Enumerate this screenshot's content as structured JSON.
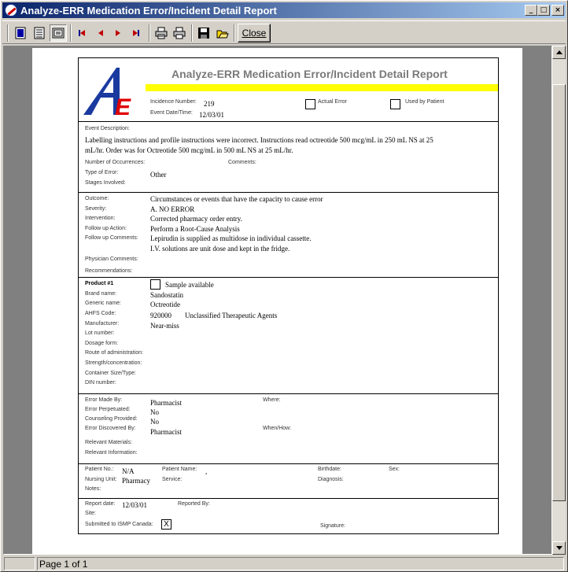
{
  "window": {
    "title": "Analyze-ERR Medication Error/Incident Detail Report"
  },
  "title_controls": {
    "minimize": "_",
    "maximize": "□",
    "close": "×"
  },
  "toolbar": {
    "close_label": "Close",
    "icons": [
      "single-page-icon",
      "multi-page-icon",
      "page-width-icon",
      "first-page-icon",
      "prev-page-icon",
      "next-page-icon",
      "last-page-icon",
      "print-setup-icon",
      "print-icon",
      "save-icon",
      "open-icon"
    ]
  },
  "report": {
    "title": "Analyze-ERR Medication Error/Incident Detail Report",
    "logo": {
      "letters": "AE",
      "colors": {
        "blue": "#1a3aa0",
        "red": "#e00000",
        "yellow": "#ffff00"
      }
    },
    "header": {
      "incidence_number_label": "Incidence Number:",
      "incidence_number": "219",
      "event_date_label": "Event Date/Time:",
      "event_date": "12/03/01",
      "actual_error_label": "Actual Error",
      "used_by_patient_label": "Used by Patient"
    },
    "event": {
      "description_label": "Event Description:",
      "description_line1": "Labelling instructions and profile instructions were incorrect. Instructions read octreotide 500 mcg/mL in 250 mL NS at 25",
      "description_line2": "mL/hr. Order was for Octreotide 500 mcg/mL in 500 mL NS at 25 mL/hr.",
      "occurrences_label": "Number of Occurrences:",
      "comments_label": "Comments:",
      "type_label": "Type of Error:",
      "type_value": "Other",
      "stages_label": "Stages Involved:"
    },
    "outcome": {
      "outcome_label": "Outcome:",
      "outcome_value": "Circumstances or events that have the capacity to cause error",
      "severity_label": "Severity:",
      "severity_value": "A. NO ERROR",
      "intervention_label": "Intervention:",
      "intervention_value": "Corrected pharmacy order entry.",
      "followup_action_label": "Follow up Action:",
      "followup_action_value": "Perform a Root-Cause Analysis",
      "followup_comments_label": "Follow up Comments:",
      "followup_comments_line1": "Lepirudin is supplied as multidose in individual cassette.",
      "followup_comments_line2": "I.V. solutions are unit dose and kept in the fridge.",
      "physician_comments_label": "Physician Comments:",
      "recommendations_label": "Recommendations:"
    },
    "product": {
      "product_label": "Product #1",
      "sample_label": "Sample available",
      "brand_label": "Brand name:",
      "brand_value": "Sandostatin",
      "generic_label": "Generic name:",
      "generic_value": "Octreotide",
      "ahfs_label": "AHFS Code:",
      "ahfs_code": "920000",
      "ahfs_desc": "Unclassified Therapeutic Agents",
      "manufacturer_label": "Manufacturer:",
      "manufacturer_value": "Near-miss",
      "lot_label": "Lot number:",
      "dosage_label": "Dosage form:",
      "route_label": "Route of administration:",
      "strength_label": "Strength/concentration:",
      "container_label": "Container Size/Type:",
      "din_label": "DIN number:"
    },
    "error": {
      "made_by_label": "Error Made By:",
      "made_by_value": "Pharmacist",
      "where_label": "Where:",
      "perpetuated_label": "Error Perpetuated:",
      "perpetuated_value": "No",
      "counseling_label": "Counseling Provided:",
      "counseling_value": "No",
      "discovered_label": "Error Discovered By:",
      "discovered_value": "Pharmacist",
      "when_label": "When/How:",
      "materials_label": "Relevant Materials:",
      "information_label": "Relevant Information:"
    },
    "patient": {
      "patient_no_label": "Patient No.:",
      "patient_no_value": "N/A",
      "patient_name_label": "Patient Name:",
      "patient_name_value": ",",
      "birthdate_label": "Birthdate:",
      "sex_label": "Sex:",
      "nursing_unit_label": "Nursing Unit:",
      "nursing_unit_value": "Pharmacy",
      "service_label": "Service:",
      "diagnosis_label": "Diagnosis:",
      "notes_label": "Notes:"
    },
    "footer": {
      "report_date_label": "Report date:",
      "report_date_value": "12/03/01",
      "reported_by_label": "Reported By:",
      "site_label": "Site:",
      "submitted_label": "Submitted to ISMP Canada:",
      "submitted_value": "X",
      "signature_label": "Signature:"
    }
  },
  "status": {
    "page": "Page 1 of 1"
  }
}
